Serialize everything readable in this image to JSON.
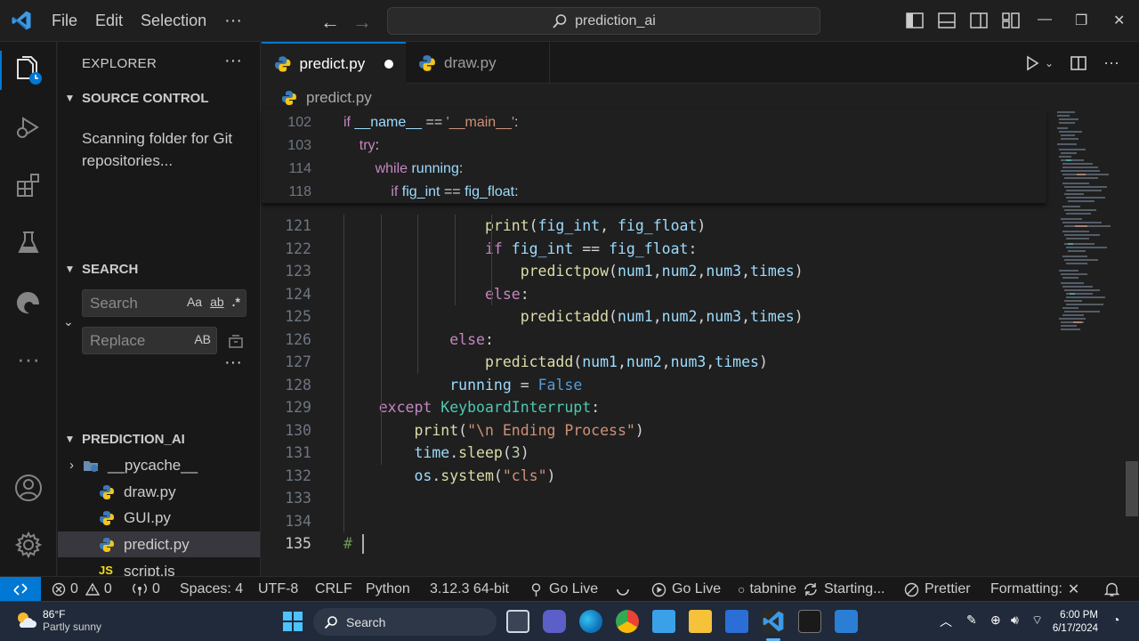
{
  "titlebar": {
    "menu": [
      "File",
      "Edit",
      "Selection",
      "···"
    ],
    "command_center": "prediction_ai",
    "window_controls": [
      "—",
      "❐",
      "✕"
    ]
  },
  "sidebar": {
    "title": "EXPLORER",
    "more": "···",
    "source_control": {
      "header": "SOURCE CONTROL",
      "message": "Scanning folder for Git repositories..."
    },
    "search": {
      "header": "SEARCH",
      "search_placeholder": "Search",
      "replace_placeholder": "Replace",
      "options": [
        "Aa",
        "ab",
        ".*"
      ],
      "replace_option": "AB"
    },
    "project": {
      "header": "PREDICTION_AI",
      "items": [
        {
          "label": "__pycache__",
          "type": "folder"
        },
        {
          "label": "draw.py",
          "type": "python"
        },
        {
          "label": "GUI.py",
          "type": "python"
        },
        {
          "label": "predict.py",
          "type": "python",
          "selected": true
        },
        {
          "label": "script.js",
          "type": "js"
        }
      ]
    }
  },
  "editor": {
    "tabs": [
      {
        "label": "predict.py",
        "active": true,
        "dirty": true
      },
      {
        "label": "draw.py",
        "active": false
      }
    ],
    "breadcrumb": "predict.py",
    "sticky_lines": [
      {
        "num": "102",
        "tokens": [
          [
            "kw",
            "if "
          ],
          [
            "var",
            "__name__"
          ],
          [
            "plain",
            " == "
          ],
          [
            "str",
            "'__main__'"
          ],
          [
            "plain",
            ":"
          ]
        ]
      },
      {
        "num": "103",
        "tokens": [
          [
            "plain",
            "    "
          ],
          [
            "kw",
            "try"
          ],
          [
            "plain",
            ":"
          ]
        ]
      },
      {
        "num": "114",
        "tokens": [
          [
            "plain",
            "        "
          ],
          [
            "kw",
            "while "
          ],
          [
            "var",
            "running"
          ],
          [
            "plain",
            ":"
          ]
        ]
      },
      {
        "num": "118",
        "tokens": [
          [
            "plain",
            "            "
          ],
          [
            "kw",
            "if "
          ],
          [
            "var",
            "fig_int"
          ],
          [
            "plain",
            " == "
          ],
          [
            "var",
            "fig_float"
          ],
          [
            "plain",
            ":"
          ]
        ]
      }
    ],
    "lines": [
      {
        "num": "121",
        "tokens": [
          [
            "plain",
            "                "
          ],
          [
            "fn",
            "print"
          ],
          [
            "plain",
            "("
          ],
          [
            "var",
            "fig_int"
          ],
          [
            "plain",
            ", "
          ],
          [
            "var",
            "fig_float"
          ],
          [
            "plain",
            ")"
          ]
        ]
      },
      {
        "num": "122",
        "tokens": [
          [
            "plain",
            "                "
          ],
          [
            "kw",
            "if "
          ],
          [
            "var",
            "fig_int"
          ],
          [
            "plain",
            " == "
          ],
          [
            "var",
            "fig_float"
          ],
          [
            "plain",
            ":"
          ]
        ]
      },
      {
        "num": "123",
        "tokens": [
          [
            "plain",
            "                    "
          ],
          [
            "fn",
            "predictpow"
          ],
          [
            "plain",
            "("
          ],
          [
            "var",
            "num1"
          ],
          [
            "plain",
            ","
          ],
          [
            "var",
            "num2"
          ],
          [
            "plain",
            ","
          ],
          [
            "var",
            "num3"
          ],
          [
            "plain",
            ","
          ],
          [
            "var",
            "times"
          ],
          [
            "plain",
            ")"
          ]
        ]
      },
      {
        "num": "124",
        "tokens": [
          [
            "plain",
            "                "
          ],
          [
            "kw",
            "else"
          ],
          [
            "plain",
            ":"
          ]
        ]
      },
      {
        "num": "125",
        "tokens": [
          [
            "plain",
            "                    "
          ],
          [
            "fn",
            "predictadd"
          ],
          [
            "plain",
            "("
          ],
          [
            "var",
            "num1"
          ],
          [
            "plain",
            ","
          ],
          [
            "var",
            "num2"
          ],
          [
            "plain",
            ","
          ],
          [
            "var",
            "num3"
          ],
          [
            "plain",
            ","
          ],
          [
            "var",
            "times"
          ],
          [
            "plain",
            ")"
          ]
        ]
      },
      {
        "num": "126",
        "tokens": [
          [
            "plain",
            "            "
          ],
          [
            "kw",
            "else"
          ],
          [
            "plain",
            ":"
          ]
        ]
      },
      {
        "num": "127",
        "tokens": [
          [
            "plain",
            "                "
          ],
          [
            "fn",
            "predictadd"
          ],
          [
            "plain",
            "("
          ],
          [
            "var",
            "num1"
          ],
          [
            "plain",
            ","
          ],
          [
            "var",
            "num2"
          ],
          [
            "plain",
            ","
          ],
          [
            "var",
            "num3"
          ],
          [
            "plain",
            ","
          ],
          [
            "var",
            "times"
          ],
          [
            "plain",
            ")"
          ]
        ]
      },
      {
        "num": "128",
        "tokens": [
          [
            "plain",
            "            "
          ],
          [
            "var",
            "running"
          ],
          [
            "plain",
            " = "
          ],
          [
            "kw2",
            "False"
          ]
        ]
      },
      {
        "num": "129",
        "tokens": [
          [
            "plain",
            "    "
          ],
          [
            "kw",
            "except "
          ],
          [
            "cls",
            "KeyboardInterrupt"
          ],
          [
            "plain",
            ":"
          ]
        ]
      },
      {
        "num": "130",
        "tokens": [
          [
            "plain",
            "        "
          ],
          [
            "fn",
            "print"
          ],
          [
            "plain",
            "("
          ],
          [
            "str",
            "\"\\n Ending Process\""
          ],
          [
            "plain",
            ")"
          ]
        ]
      },
      {
        "num": "131",
        "tokens": [
          [
            "plain",
            "        "
          ],
          [
            "var",
            "time"
          ],
          [
            "plain",
            "."
          ],
          [
            "fn",
            "sleep"
          ],
          [
            "plain",
            "("
          ],
          [
            "num",
            "3"
          ],
          [
            "plain",
            ")"
          ]
        ]
      },
      {
        "num": "132",
        "tokens": [
          [
            "plain",
            "        "
          ],
          [
            "var",
            "os"
          ],
          [
            "plain",
            "."
          ],
          [
            "fn",
            "system"
          ],
          [
            "plain",
            "("
          ],
          [
            "str",
            "\"cls\""
          ],
          [
            "plain",
            ")"
          ]
        ]
      },
      {
        "num": "133",
        "tokens": []
      },
      {
        "num": "134",
        "tokens": []
      },
      {
        "num": "135",
        "tokens": [
          [
            "cmt",
            "# "
          ]
        ]
      }
    ]
  },
  "statusbar": {
    "errors": "0",
    "warnings": "0",
    "ports": "0",
    "spaces": "Spaces: 4",
    "encoding": "UTF-8",
    "eol": "CRLF",
    "language": "Python",
    "interpreter": "3.12.3 64-bit",
    "golive1": "Go Live",
    "golive2": "Go Live",
    "tabnine": "tabnine",
    "starting": "Starting...",
    "prettier": "Prettier",
    "formatting": "Formatting:"
  },
  "taskbar": {
    "temp": "86°F",
    "weather": "Partly sunny",
    "search": "Search",
    "time": "6:00 PM",
    "date": "6/17/2024"
  },
  "colors": {
    "accent": "#0078d4",
    "keyword": "#c586c0",
    "string": "#ce9178",
    "function": "#dcdcaa",
    "class": "#4ec9b0"
  }
}
